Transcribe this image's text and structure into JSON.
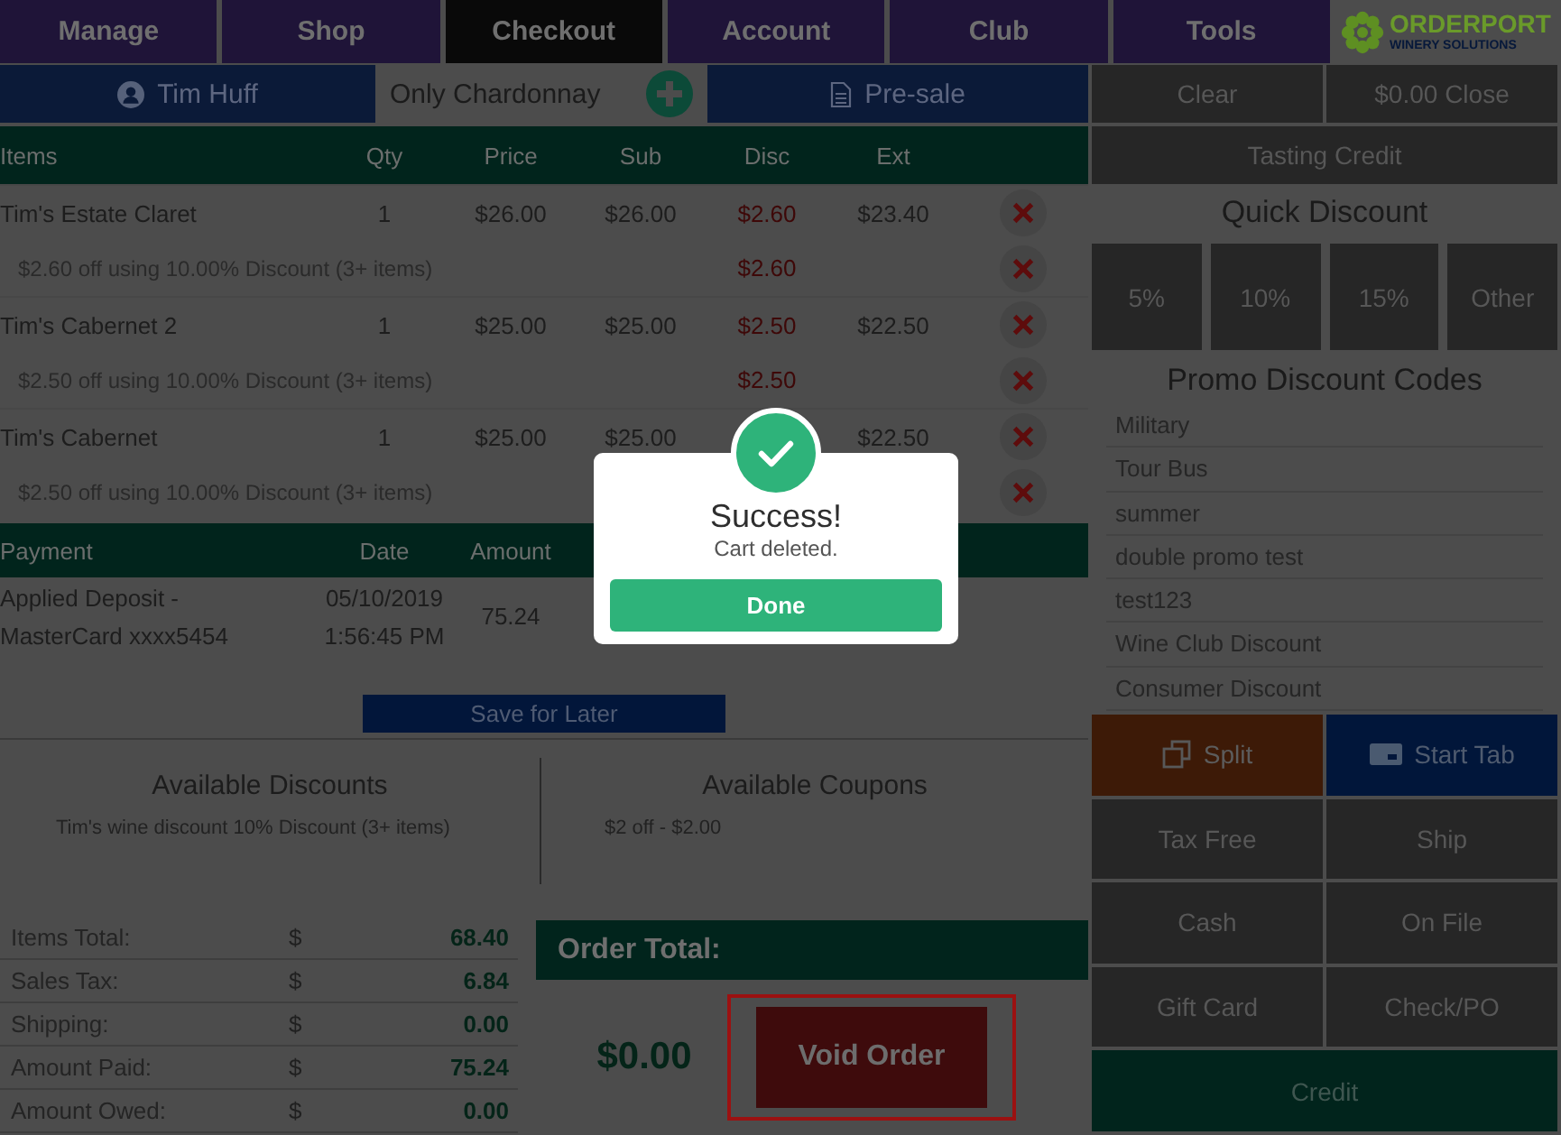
{
  "nav": {
    "tabs": [
      {
        "label": "Manage",
        "selected": false
      },
      {
        "label": "Shop",
        "selected": false
      },
      {
        "label": "Checkout",
        "selected": true
      },
      {
        "label": "Account",
        "selected": false
      },
      {
        "label": "Club",
        "selected": false
      },
      {
        "label": "Tools",
        "selected": false
      }
    ],
    "logo": {
      "wordmark": "ORDERPORT",
      "tagline": "WINERY SOLUTIONS"
    }
  },
  "toolbar": {
    "customer": "Tim Huff",
    "club": "Only Chardonnay",
    "order_type": "Pre-sale"
  },
  "cart": {
    "columns": [
      "Items",
      "Qty",
      "Price",
      "Sub",
      "Disc",
      "Ext"
    ],
    "rows": [
      {
        "kind": "item",
        "name": "Tim's Estate Claret",
        "qty": "1",
        "price": "$26.00",
        "sub": "$26.00",
        "disc": "$2.60",
        "ext": "$23.40"
      },
      {
        "kind": "discount",
        "name": "$2.60 off using 10.00% Discount (3+ items)",
        "disc": "$2.60"
      },
      {
        "kind": "item",
        "name": "Tim's Cabernet 2",
        "qty": "1",
        "price": "$25.00",
        "sub": "$25.00",
        "disc": "$2.50",
        "ext": "$22.50"
      },
      {
        "kind": "discount",
        "name": "$2.50 off using 10.00% Discount (3+ items)",
        "disc": "$2.50"
      },
      {
        "kind": "item",
        "name": "Tim's Cabernet",
        "qty": "1",
        "price": "$25.00",
        "sub": "$25.00",
        "ext": "$22.50"
      },
      {
        "kind": "discount",
        "name": "$2.50 off using 10.00% Discount (3+ items)"
      }
    ]
  },
  "payments": {
    "columns": [
      "Payment",
      "Date",
      "Amount"
    ],
    "rows": [
      {
        "method": "Applied Deposit - MasterCard xxxx5454",
        "date": "05/10/2019 1:56:45 PM",
        "amount": "75.24"
      }
    ]
  },
  "save_button": "Save for Later",
  "available_discounts": {
    "title": "Available Discounts",
    "items": [
      "Tim's wine discount 10% Discount (3+ items)"
    ]
  },
  "available_coupons": {
    "title": "Available Coupons",
    "items": [
      "$2 off - $2.00"
    ]
  },
  "totals": [
    {
      "label": "Items Total:",
      "currency": "$",
      "value": "68.40"
    },
    {
      "label": "Sales Tax:",
      "currency": "$",
      "value": "6.84"
    },
    {
      "label": "Shipping:",
      "currency": "$",
      "value": "0.00"
    },
    {
      "label": "Amount Paid:",
      "currency": "$",
      "value": "75.24"
    },
    {
      "label": "Amount Owed:",
      "currency": "$",
      "value": "0.00"
    }
  ],
  "order_total": {
    "title": "Order Total:",
    "amount": "$0.00",
    "void_button": {
      "label": "Void Order",
      "highlighted": true
    }
  },
  "side": {
    "top_buttons": [
      "Clear",
      "$0.00 Close"
    ],
    "tasting_credit": "Tasting Credit",
    "quick_discount": {
      "title": "Quick Discount",
      "options": [
        "5%",
        "10%",
        "15%",
        "Other"
      ]
    },
    "promo_codes": {
      "title": "Promo Discount Codes",
      "codes": [
        "Military",
        "Tour Bus",
        "summer",
        "double promo test",
        "test123",
        "Wine Club Discount",
        "Consumer Discount"
      ]
    },
    "actions": [
      {
        "label": "Split",
        "kind": "split"
      },
      {
        "label": "Start Tab",
        "kind": "tab"
      },
      {
        "label": "Tax Free",
        "kind": "plain"
      },
      {
        "label": "Ship",
        "kind": "plain"
      },
      {
        "label": "Cash",
        "kind": "plain"
      },
      {
        "label": "On File",
        "kind": "plain"
      },
      {
        "label": "Gift Card",
        "kind": "plain"
      },
      {
        "label": "Check/PO",
        "kind": "plain"
      },
      {
        "label": "Credit",
        "kind": "wide"
      }
    ]
  },
  "dialog": {
    "title": "Success!",
    "message": "Cart deleted.",
    "button": "Done"
  }
}
